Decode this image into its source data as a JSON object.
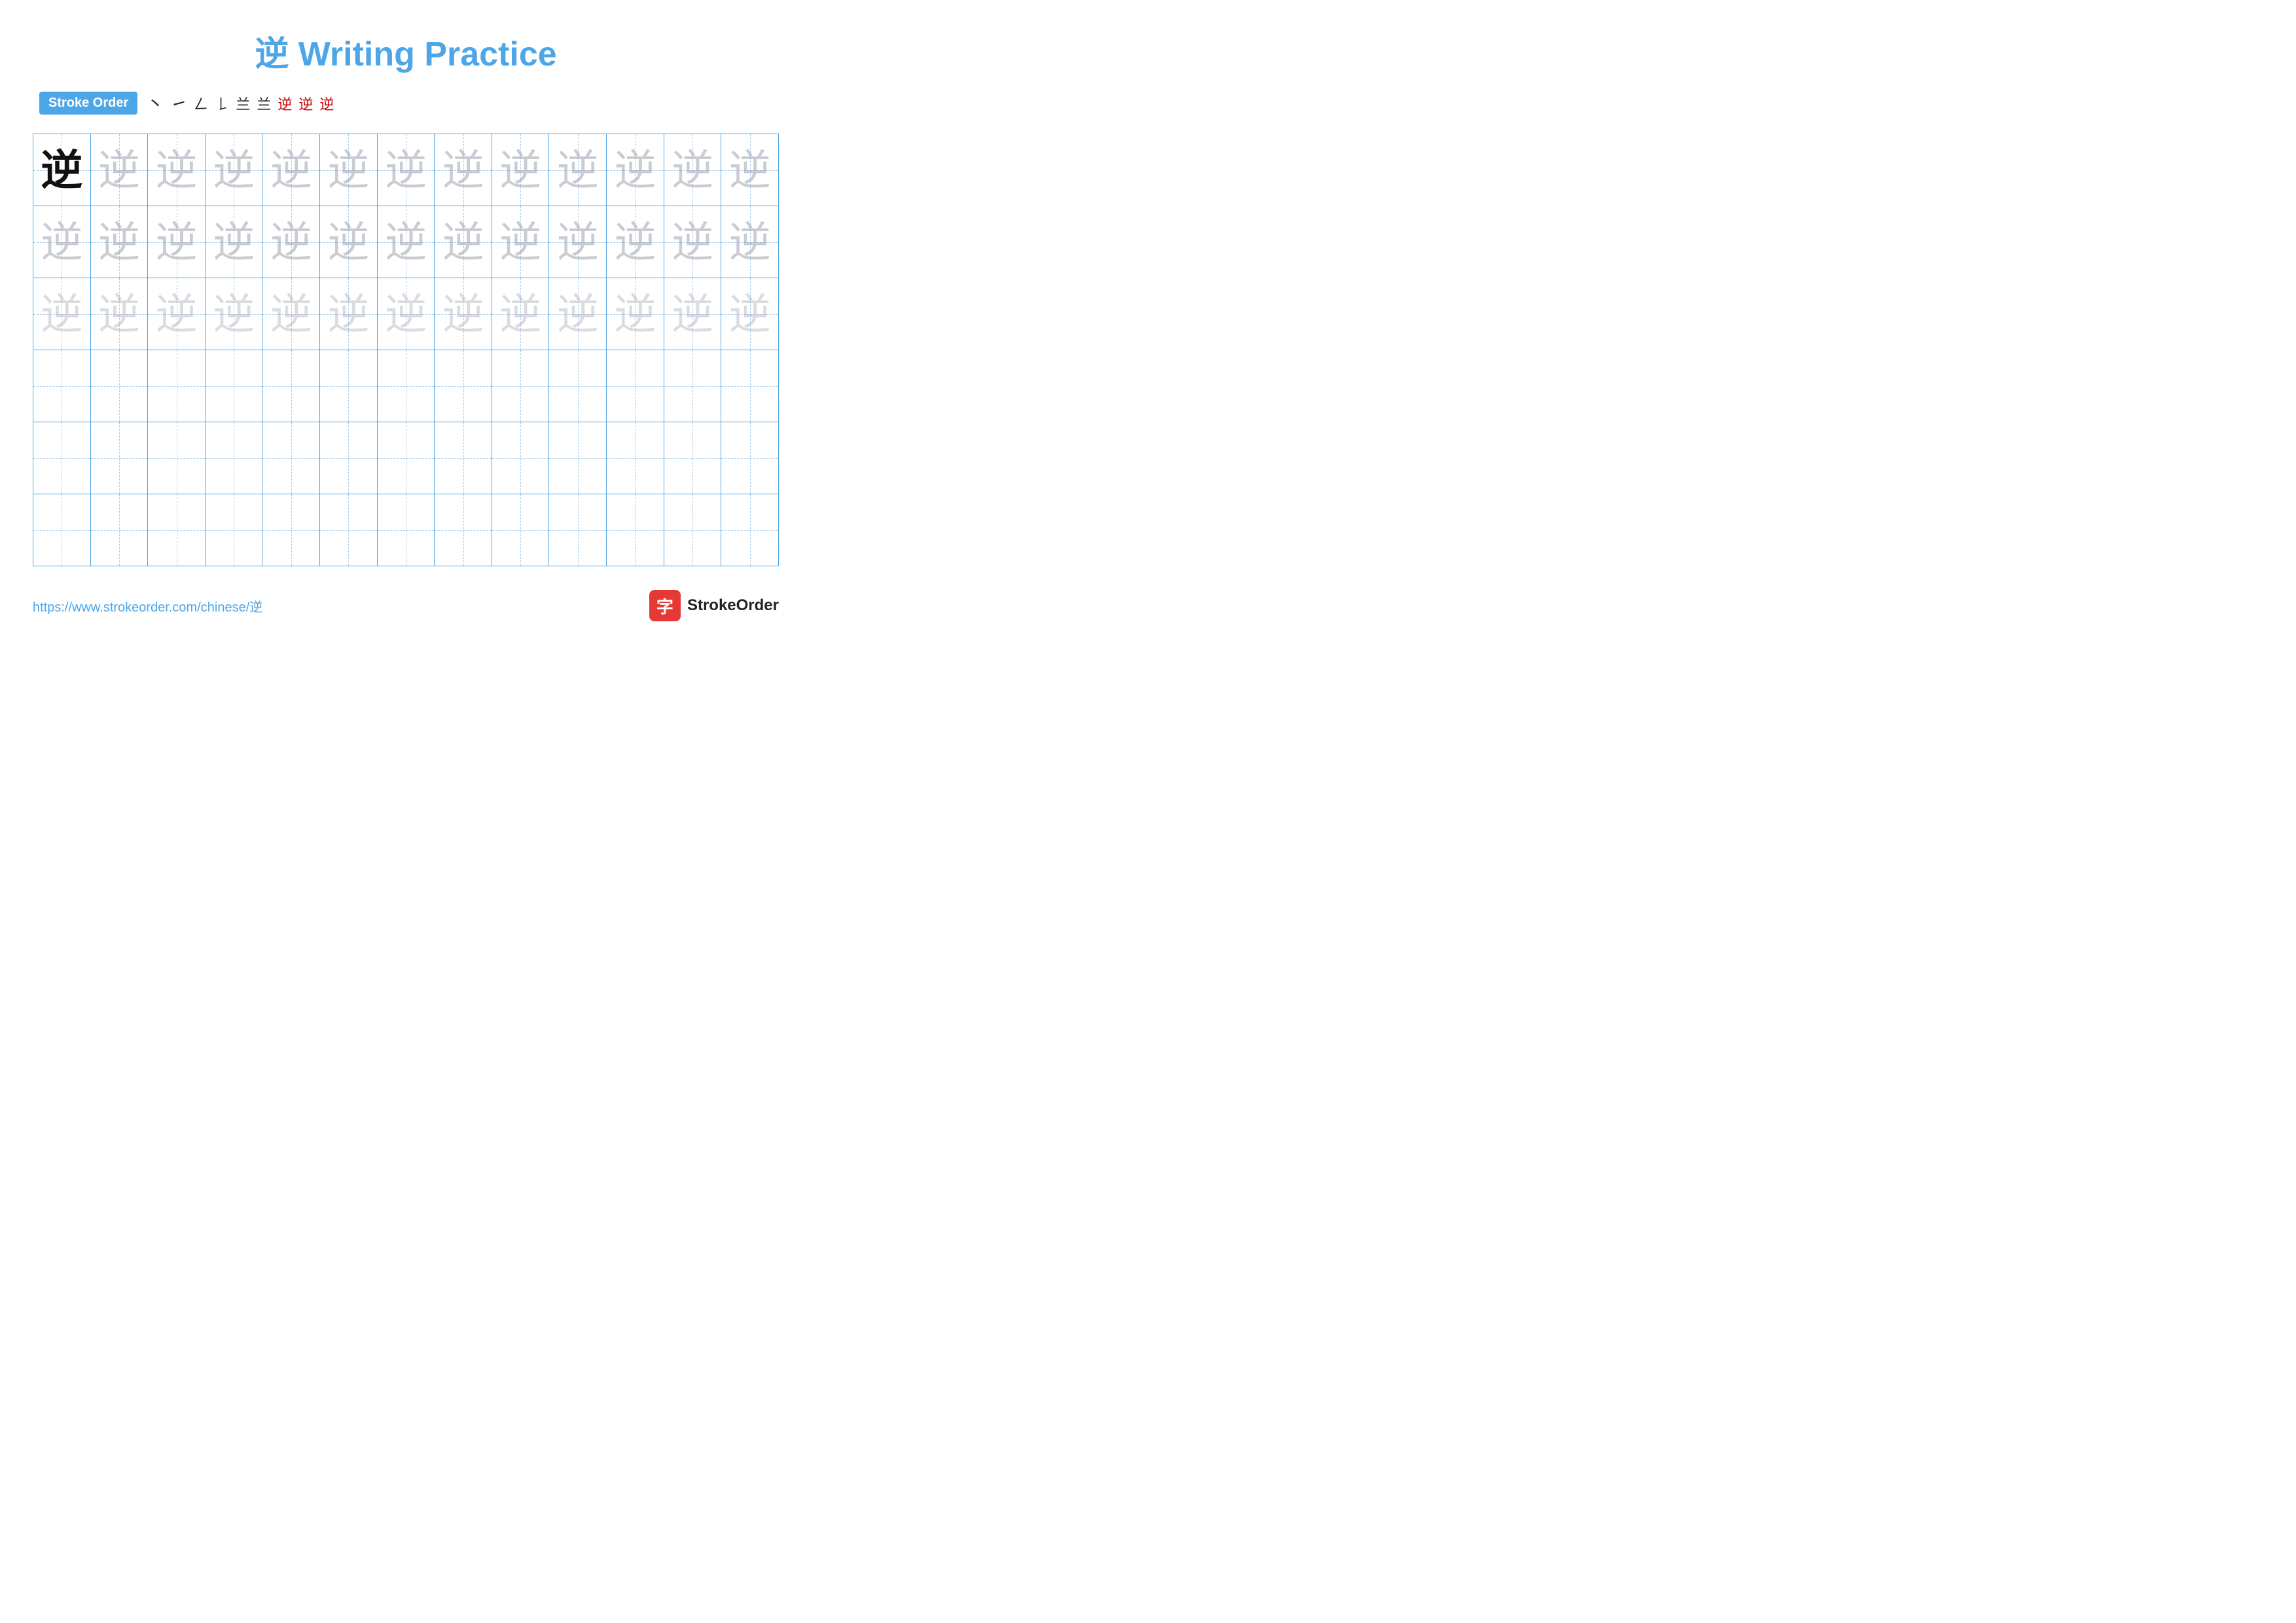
{
  "header": {
    "title": "逆 Writing Practice"
  },
  "stroke_order": {
    "badge_label": "Stroke Order",
    "strokes": [
      "丶",
      "㇀",
      "𠃊",
      "𠃎",
      "𠄌",
      "𠄏",
      "逆̶",
      "逆̷",
      "逆"
    ]
  },
  "grid": {
    "rows": 6,
    "cols": 13,
    "character": "逆"
  },
  "footer": {
    "url": "https://www.strokeorder.com/chinese/逆",
    "logo_text": "StrokeOrder",
    "logo_icon": "字"
  }
}
